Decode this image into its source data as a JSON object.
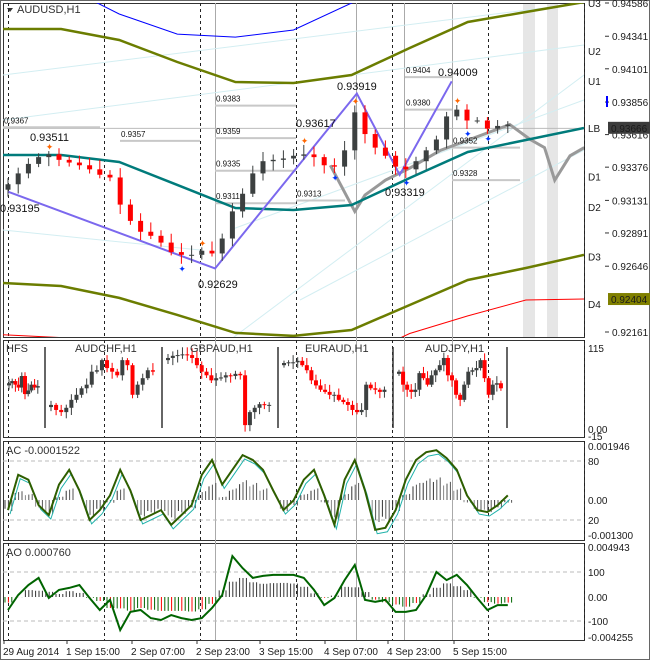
{
  "header": {
    "symbol_title": "AUDUSD,H1"
  },
  "price_axis": {
    "ticks": [
      "0.94586",
      "0.94341",
      "0.94101",
      "0.93856",
      "0.93616",
      "0.93376",
      "0.93131",
      "0.92891",
      "0.92646",
      "0.92161"
    ],
    "current_price": "0.93666",
    "band_price": "0.92404",
    "current_color": "#3c3c3c",
    "band_color": "#808000"
  },
  "levels": {
    "names": [
      "U3",
      "U2",
      "U1",
      "LB",
      "D1",
      "D2",
      "D3",
      "D4"
    ],
    "prices": [
      0.94586,
      0.94231,
      0.94011,
      0.93666,
      0.93306,
      0.93081,
      0.92716,
      0.92366
    ]
  },
  "level_labels": [
    "0.9367",
    "0.9357",
    "0.9383",
    "0.9359",
    "0.9335",
    "0.9311",
    "0.9313",
    "0.9404",
    "0.9380",
    "0.9352",
    "0.9328"
  ],
  "zigzag_labels": [
    "0.93195",
    "0.93511",
    "0.92629",
    "0.93617",
    "0.93919",
    "0.93319",
    "0.94009"
  ],
  "time_axis": [
    "29 Aug 2014",
    "1 Sep 15:00",
    "2 Sep 07:00",
    "2 Sep 23:00",
    "3 Sep 15:00",
    "4 Sep 07:00",
    "4 Sep 23:00",
    "5 Sep 15:00"
  ],
  "chart_data": {
    "type": "candlestick",
    "title": "AUDUSD,H1",
    "ylim": [
      0.92161,
      0.94586
    ],
    "close": [
      0.9325,
      0.9333,
      0.934,
      0.9345,
      0.9347,
      0.9343,
      0.9341,
      0.9339,
      0.9336,
      0.9332,
      0.933,
      0.931,
      0.9298,
      0.929,
      0.9287,
      0.9282,
      0.9275,
      0.9273,
      0.9273,
      0.9276,
      0.9274,
      0.9285,
      0.9305,
      0.9318,
      0.9333,
      0.9342,
      0.9343,
      0.9344,
      0.9346,
      0.9347,
      0.9345,
      0.9339,
      0.9338,
      0.935,
      0.9378,
      0.9362,
      0.9352,
      0.9346,
      0.9338,
      0.9336,
      0.9342,
      0.935,
      0.9358,
      0.9375,
      0.938,
      0.9372,
      0.9372,
      0.9366,
      0.9368,
      0.9369
    ],
    "ma_teal": [
      0.93466,
      0.93466,
      0.93414,
      0.93245,
      0.93075,
      0.9306,
      0.93097,
      0.93296,
      0.93488,
      0.93576,
      0.93665
    ],
    "band_upper": [
      0.94394,
      0.94394,
      0.94313,
      0.94151,
      0.94004,
      0.93996,
      0.94055,
      0.94254,
      0.94446,
      0.9452,
      0.94593
    ],
    "band_lower": [
      0.92522,
      0.925,
      0.92412,
      0.92287,
      0.92154,
      0.92132,
      0.92176,
      0.9236,
      0.92544,
      0.92633,
      0.92729
    ],
    "band_outer_upper": [
      0.948,
      0.9472,
      0.94505,
      0.94357,
      0.94335,
      0.94387,
      0.94586,
      0.948,
      0.949,
      0.95,
      0.951
    ],
    "band_outer_lower": [
      0.9214,
      0.9212,
      0.92,
      0.919,
      0.9185,
      0.9185,
      0.9195,
      0.9215,
      0.9228,
      0.92397,
      0.92404
    ],
    "zigzag": [
      [
        0,
        0.93195
      ],
      [
        20.3,
        0.92629
      ],
      [
        34.2,
        0.93919
      ],
      [
        38.4,
        0.93319
      ],
      [
        43.5,
        0.94009
      ]
    ],
    "projection": [
      [
        31.6,
        0.9339
      ],
      [
        34,
        0.9305
      ],
      [
        35,
        0.9317
      ],
      [
        37,
        0.9328
      ],
      [
        39.4,
        0.9337
      ],
      [
        42.4,
        0.935
      ],
      [
        49.2,
        0.9369
      ],
      [
        51.2,
        0.9358
      ],
      [
        52.6,
        0.9352
      ],
      [
        53.6,
        0.9328
      ],
      [
        55.1,
        0.9346
      ],
      [
        56.5,
        0.9352
      ]
    ],
    "hfs": {
      "title": "HFS",
      "scale": [
        "115",
        "0.00",
        "-15"
      ],
      "panels": [
        {
          "name": "",
          "close": [
            62,
            65,
            60,
            56,
            72,
            47,
            52,
            60,
            56,
            58
          ]
        },
        {
          "name": "AUDCHF,H1",
          "close": [
            32,
            25,
            22,
            28,
            39,
            46,
            55,
            60,
            78,
            80,
            94,
            83,
            78,
            73,
            94,
            87,
            46,
            60,
            69,
            80,
            78
          ]
        },
        {
          "name": "GBPAUD,H1",
          "close": [
            97,
            100,
            101,
            102,
            101,
            97,
            87,
            78,
            73,
            66,
            69,
            70,
            73,
            72,
            75,
            73,
            4,
            22,
            28,
            33,
            32,
            32
          ]
        },
        {
          "name": "EURAUD,H1",
          "close": [
            90,
            91,
            91,
            93,
            87,
            80,
            66,
            59,
            53,
            50,
            46,
            46,
            39,
            36,
            32,
            25,
            22,
            25,
            60,
            55,
            53,
            50,
            53
          ]
        },
        {
          "name": "AUDJPY,H1",
          "close": [
            78,
            60,
            53,
            50,
            53,
            76,
            69,
            60,
            73,
            80,
            87,
            97,
            73,
            66,
            46,
            39,
            60,
            78,
            80,
            83,
            94,
            69,
            46,
            60,
            62,
            55
          ]
        }
      ]
    },
    "ac": {
      "title": "AC -0.0001522",
      "scale": [
        "0.001946",
        "80",
        "0.00",
        "20",
        "-0.001300"
      ],
      "line": [
        30,
        66,
        61,
        35,
        25,
        56,
        71,
        50,
        20,
        30,
        45,
        71,
        50,
        20,
        25,
        30,
        15,
        25,
        35,
        66,
        81,
        56,
        71,
        86,
        81,
        71,
        50,
        30,
        40,
        61,
        71,
        45,
        15,
        61,
        81,
        50,
        10,
        12,
        30,
        61,
        81,
        89,
        91,
        83,
        71,
        45,
        30,
        28,
        35,
        45
      ]
    },
    "ao": {
      "title": "AO 0.000760",
      "scale": [
        "0.004943",
        "100",
        "0.00",
        "-100",
        "-0.004255"
      ],
      "line": [
        -55,
        6,
        47,
        76,
        -6,
        27,
        35,
        47,
        -6,
        -55,
        -14,
        -137,
        -63,
        -55,
        -88,
        -96,
        -76,
        -88,
        -96,
        -88,
        -47,
        6,
        165,
        116,
        76,
        84,
        88,
        88,
        88,
        76,
        27,
        -35,
        -6,
        67,
        129,
        -14,
        -22,
        -14,
        -63,
        -63,
        -55,
        6,
        100,
        67,
        88,
        47,
        -6,
        -55,
        -35,
        -35
      ]
    }
  }
}
